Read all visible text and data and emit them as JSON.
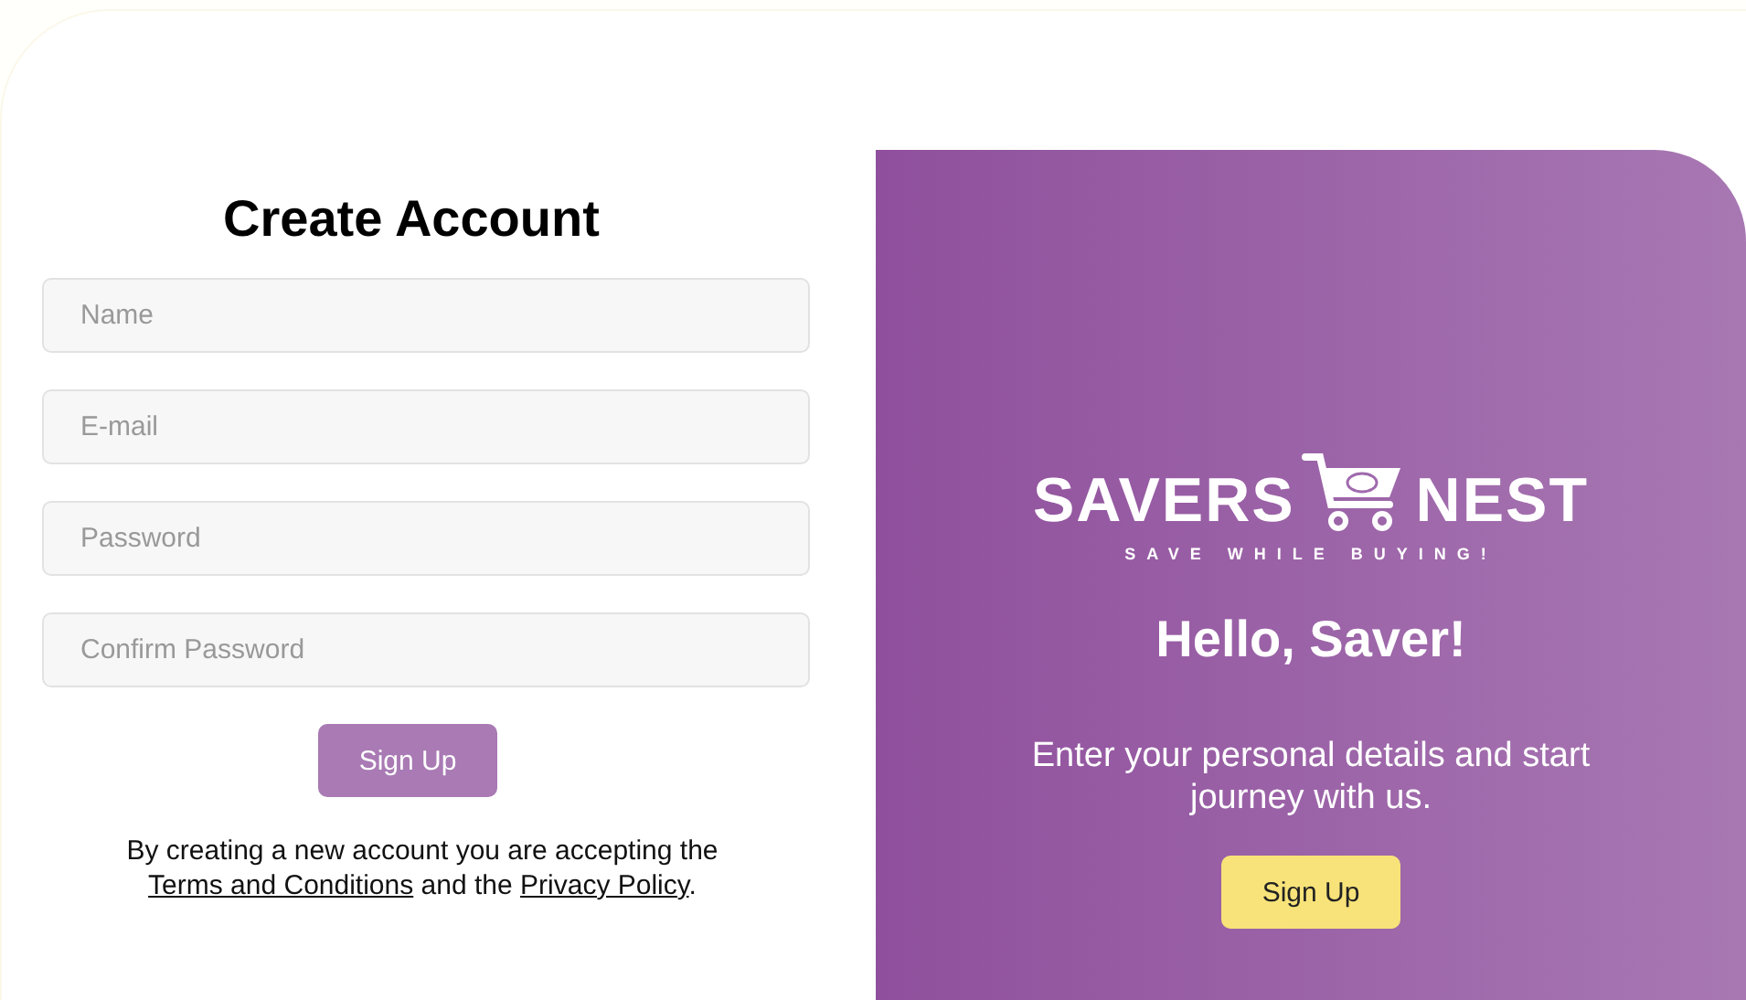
{
  "form": {
    "title": "Create Account",
    "fields": [
      {
        "placeholder": "Name"
      },
      {
        "placeholder": "E-mail"
      },
      {
        "placeholder": "Password"
      },
      {
        "placeholder": "Confirm Password"
      }
    ],
    "submit": "Sign Up",
    "terms": {
      "before": "By creating a new account you are accepting the",
      "link_1": "Terms and Conditions",
      "middle": "and the",
      "link_2": "Privacy Policy",
      "after": "."
    }
  },
  "panel": {
    "logo": {
      "word_1": "SAVERS",
      "word_2": "NEST",
      "tagline": "SAVE WHILE BUYING!"
    },
    "heading": "Hello, Saver!",
    "text": "Enter your personal details and start journey with us.",
    "button": "Sign Up"
  }
}
